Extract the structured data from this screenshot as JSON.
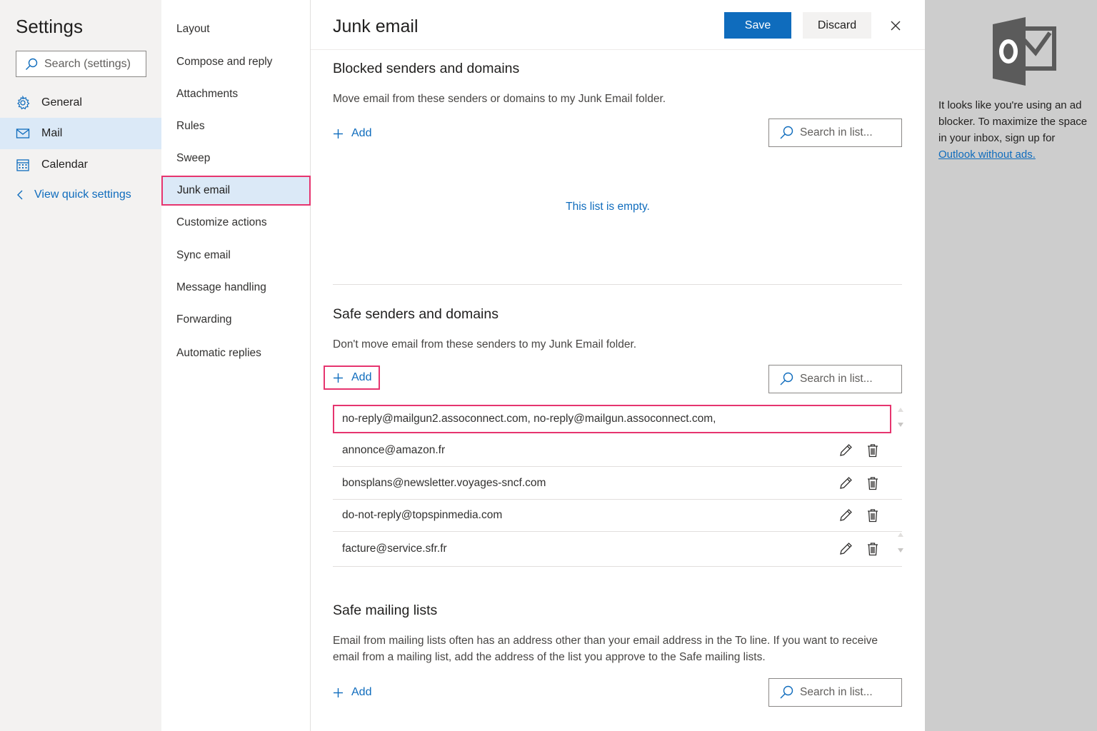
{
  "settings": {
    "title": "Settings",
    "search_placeholder": "Search (settings)",
    "nav": [
      {
        "label": "General",
        "icon": "gear-icon",
        "active": false
      },
      {
        "label": "Mail",
        "icon": "mail-icon",
        "active": true
      },
      {
        "label": "Calendar",
        "icon": "calendar-icon",
        "active": false
      }
    ],
    "quick_settings": "View quick settings"
  },
  "categories": [
    {
      "label": "Layout"
    },
    {
      "label": "Compose and reply"
    },
    {
      "label": "Attachments"
    },
    {
      "label": "Rules"
    },
    {
      "label": "Sweep"
    },
    {
      "label": "Junk email",
      "active": true
    },
    {
      "label": "Customize actions"
    },
    {
      "label": "Sync email"
    },
    {
      "label": "Message handling"
    },
    {
      "label": "Forwarding"
    },
    {
      "label": "Automatic replies"
    }
  ],
  "panel": {
    "title": "Junk email",
    "save_label": "Save",
    "discard_label": "Discard"
  },
  "blocked": {
    "title": "Blocked senders and domains",
    "description": "Move email from these senders or domains to my Junk Email folder.",
    "add_label": "Add",
    "search_placeholder": "Search in list...",
    "empty_message": "This list is empty."
  },
  "safe_senders": {
    "title": "Safe senders and domains",
    "description": "Don't move email from these senders to my Junk Email folder.",
    "add_label": "Add",
    "search_placeholder": "Search in list...",
    "input_value": "no-reply@mailgun2.assoconnect.com, no-reply@mailgun.assoconnect.com,",
    "entries": [
      "annonce@amazon.fr",
      "bonsplans@newsletter.voyages-sncf.com",
      "do-not-reply@topspinmedia.com",
      "facture@service.sfr.fr"
    ]
  },
  "safe_mailing": {
    "title": "Safe mailing lists",
    "description": "Email from mailing lists often has an address other than your email address in the To line. If you want to receive email from a mailing list, add the address of the list you approve to the Safe mailing lists.",
    "add_label": "Add",
    "search_placeholder": "Search in list..."
  },
  "ad": {
    "text": "It looks like you're using an ad blocker. To maximize the space in your inbox, sign up for",
    "link": "Outlook without ads."
  },
  "colors": {
    "accent": "#0f6cbd",
    "highlight": "#e6356f",
    "nav_active": "#dbe9f7"
  }
}
